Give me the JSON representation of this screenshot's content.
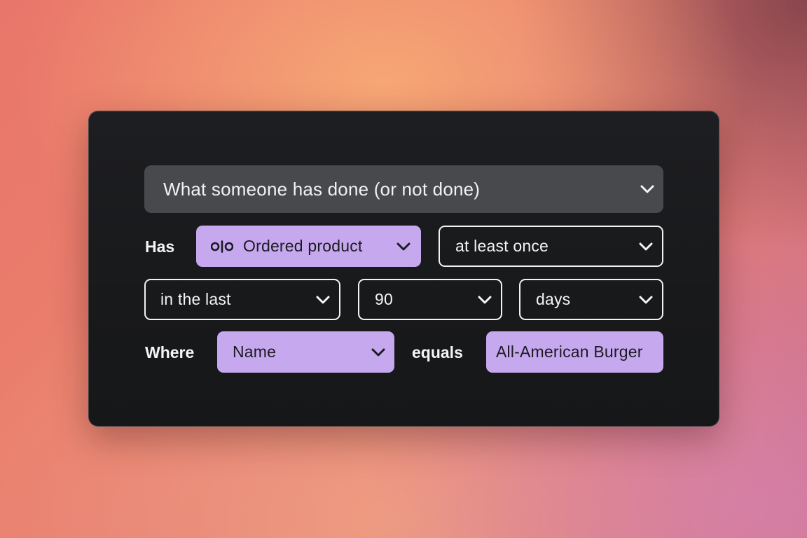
{
  "filter": {
    "condition_select": "What someone has done (or not done)",
    "has_label": "Has",
    "event_select": "Ordered product",
    "event_icon": "olo-icon",
    "frequency_select": "at least once",
    "timeframe_select": "in the last",
    "amount_select": "90",
    "unit_select": "days",
    "where_label": "Where",
    "property_select": "Name",
    "operator_label": "equals",
    "value_field": "All-American Burger"
  },
  "colors": {
    "panel": "#1a1b1d",
    "header_bg": "#48494c",
    "accent_lilac": "#c6a8ee",
    "outline": "#f2f2f2"
  }
}
